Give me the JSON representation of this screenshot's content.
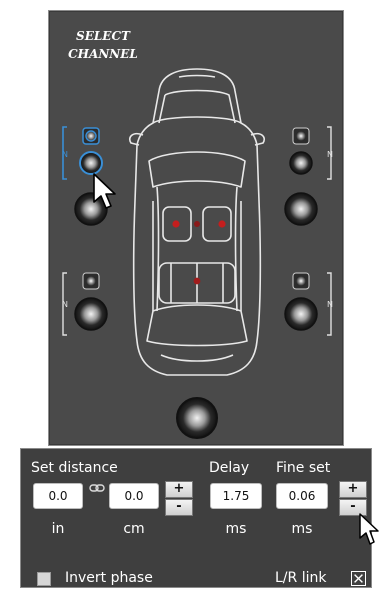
{
  "panel": {
    "title": "SELECT\nCHANNEL"
  },
  "speaker_channels": {
    "front_left": {
      "bracket_letter": "N"
    },
    "front_right": {
      "bracket_letter": "N"
    },
    "rear_left": {
      "bracket_letter": "N"
    },
    "rear_right": {
      "bracket_letter": "N"
    }
  },
  "controls": {
    "set_distance_label": "Set distance",
    "delay_label": "Delay",
    "fine_set_label": "Fine set",
    "distance_in_value": "0.0",
    "distance_cm_value": "0.0",
    "delay_value": "1.75",
    "fine_set_value": "0.06",
    "unit_in": "in",
    "unit_cm": "cm",
    "unit_delay": "ms",
    "unit_fine": "ms",
    "plus_label": "+",
    "minus_label": "-",
    "invert_phase_label": "Invert phase",
    "lr_link_label": "L/R link",
    "invert_phase_checked": false,
    "lr_link_checked": true
  },
  "colors": {
    "panel_bg": "#4a4a4a",
    "controls_bg": "#3f3f3f",
    "selected_channel": "#3a8fd6",
    "seat_dot": "#c41e1e"
  }
}
